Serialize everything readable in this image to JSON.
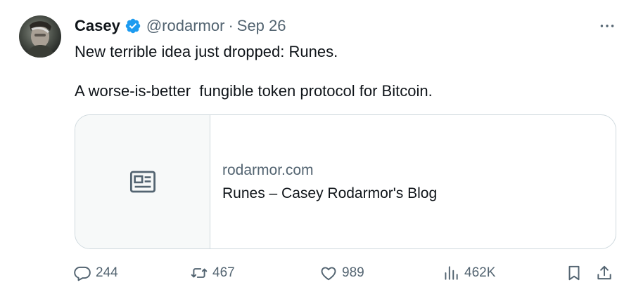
{
  "author": {
    "display_name": "Casey",
    "handle": "@rodarmor",
    "separator": "·",
    "date": "Sep 26",
    "verified_color": "#1d9bf0"
  },
  "tweet": {
    "lines": [
      "New terrible idea just dropped: Runes.",
      "A worse-is-better  fungible token protocol for Bitcoin."
    ]
  },
  "card": {
    "domain": "rodarmor.com",
    "title": "Runes – Casey Rodarmor's Blog",
    "thumbnail_icon": "news-article-icon"
  },
  "actions": {
    "replies": "244",
    "retweets": "467",
    "likes": "989",
    "views": "462K"
  },
  "colors": {
    "text": "#0f1419",
    "muted": "#536471",
    "border": "#cfd9de"
  }
}
